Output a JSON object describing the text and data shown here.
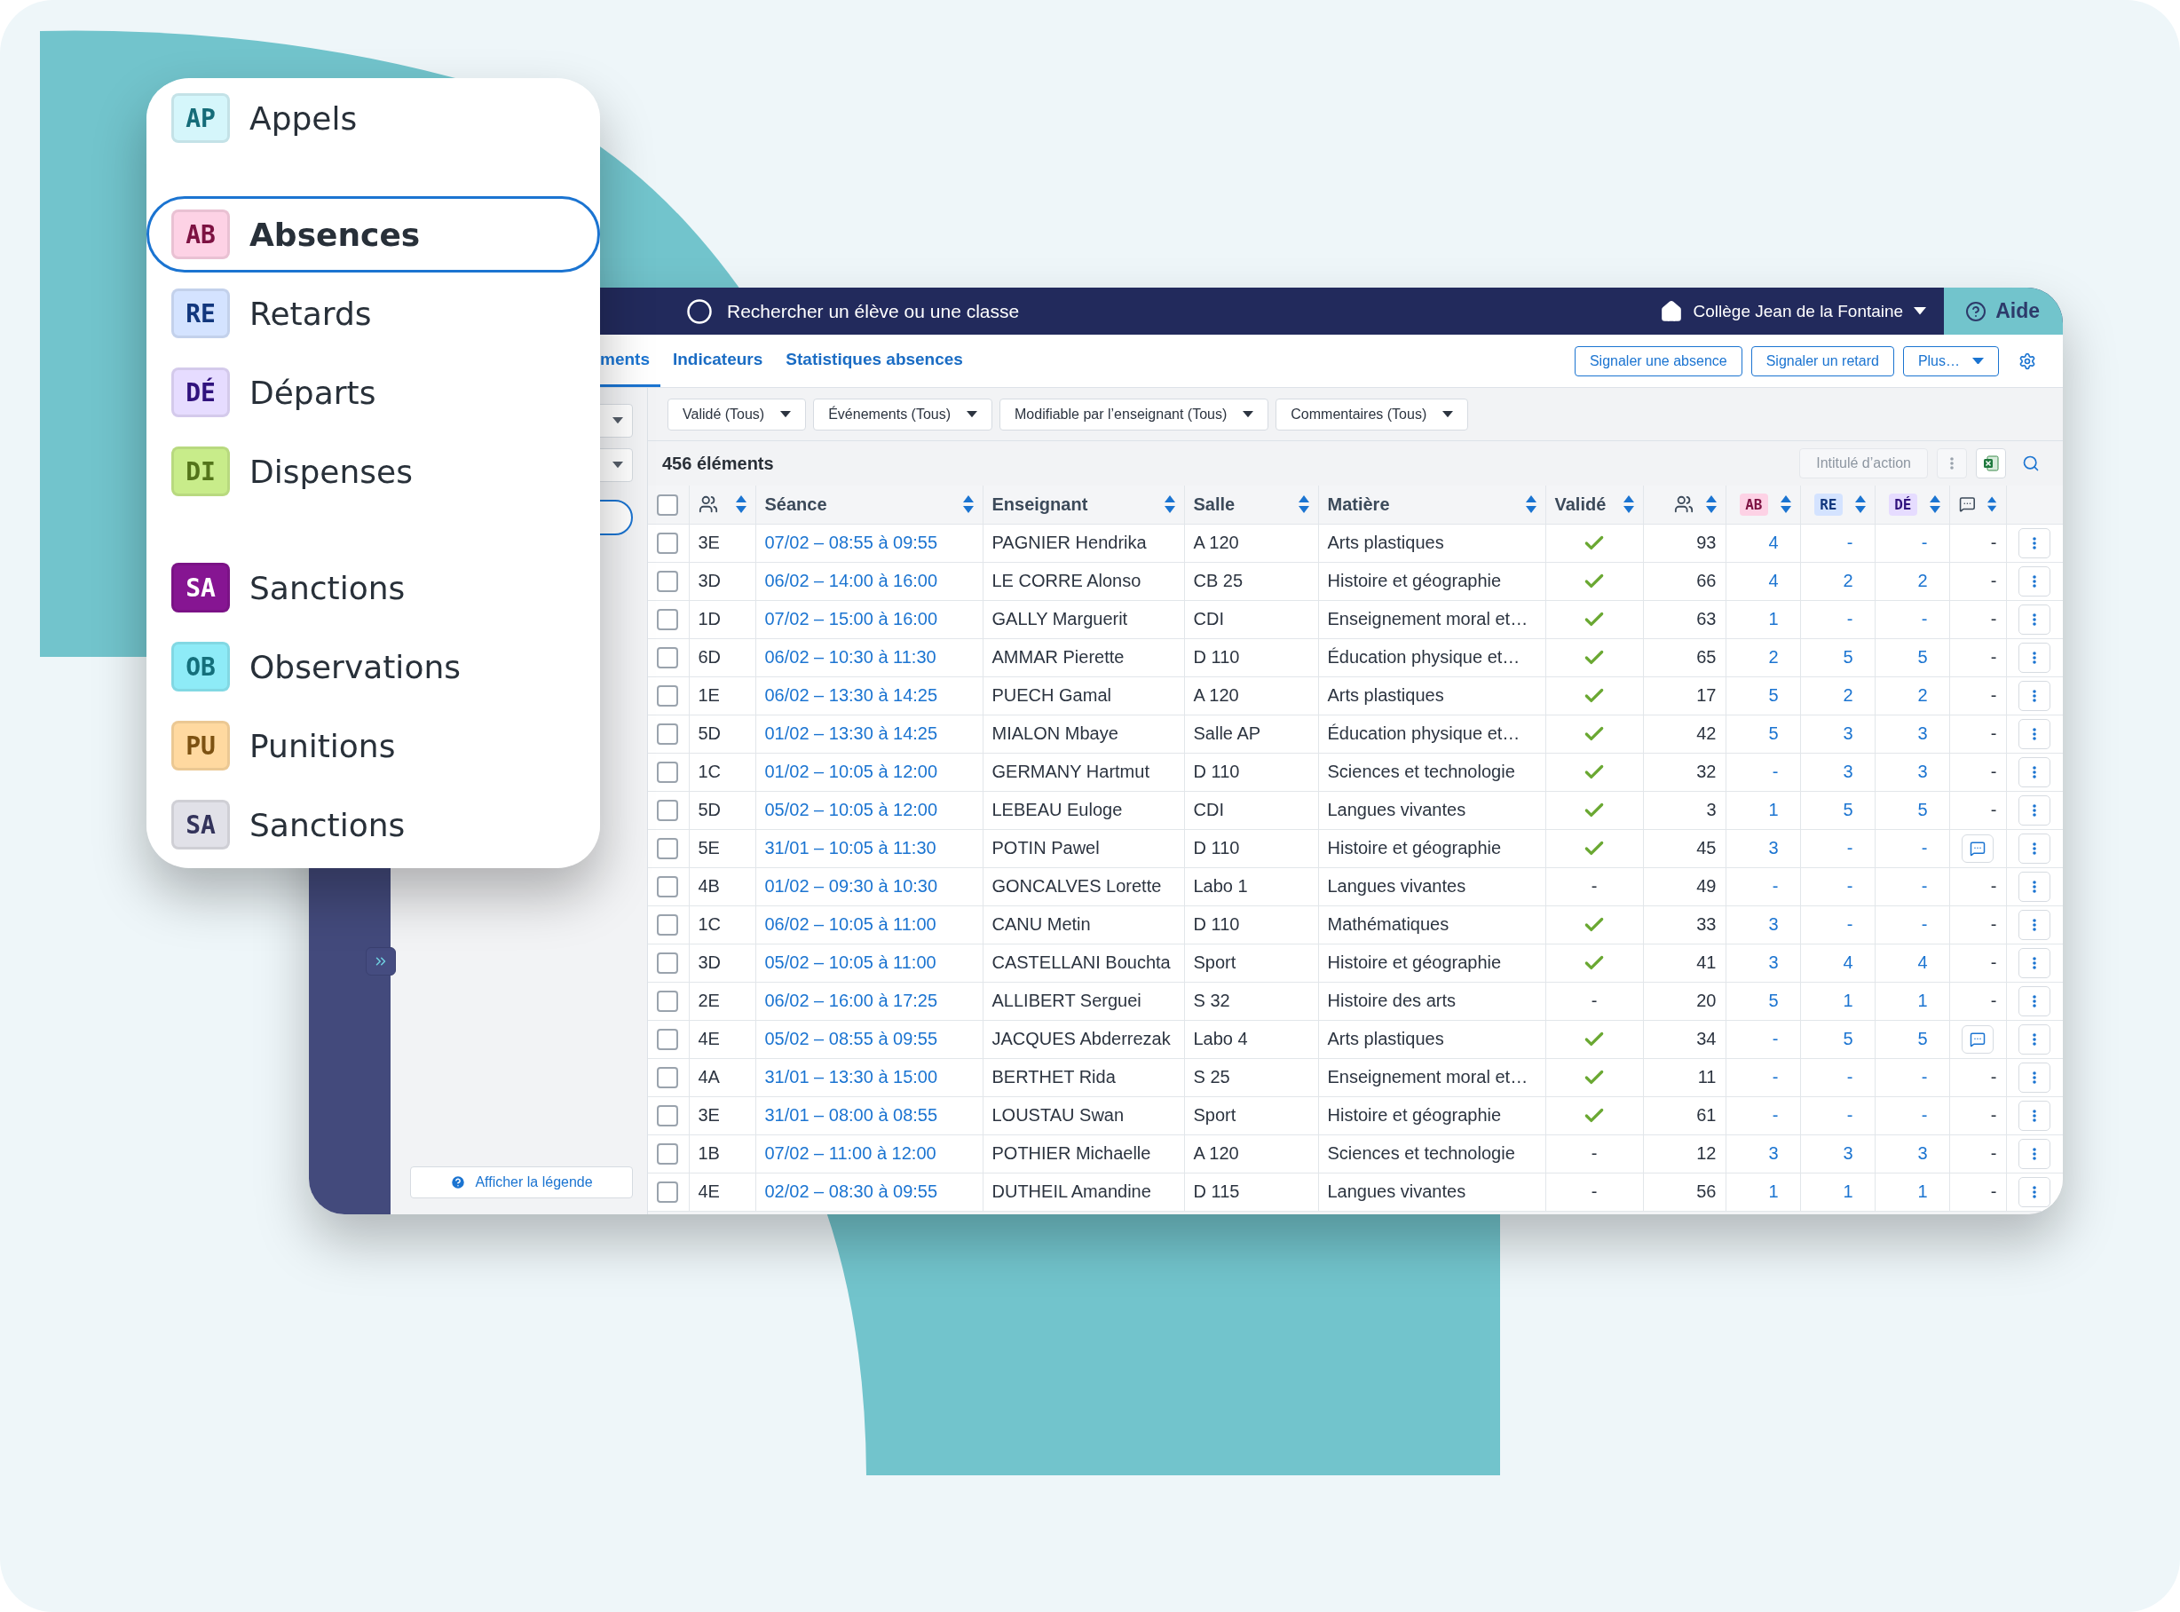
{
  "popup": {
    "groups": [
      {
        "items": [
          {
            "code": "AP",
            "label": "Appels",
            "color": "#d5f6fb",
            "selected": false
          }
        ]
      },
      {
        "items": [
          {
            "code": "AB",
            "label": "Absences",
            "color": "#fdd2e5",
            "selected": true
          },
          {
            "code": "RE",
            "label": "Retards",
            "color": "#d4e3ff",
            "selected": false
          },
          {
            "code": "DÉ",
            "label": "Départs",
            "color": "#e6dcff",
            "selected": false
          },
          {
            "code": "DI",
            "label": "Dispenses",
            "color": "#c8ec8a",
            "selected": false
          }
        ]
      },
      {
        "items": [
          {
            "code": "SA",
            "label": "Sanctions",
            "color": "#861592",
            "selected": false
          },
          {
            "code": "OB",
            "label": "Observations",
            "color": "#8eebf7",
            "selected": false
          },
          {
            "code": "PU",
            "label": "Punitions",
            "color": "#ffd9a0",
            "selected": false
          },
          {
            "code": "SA",
            "label": "Sanctions",
            "color": "#e1e1e8",
            "selected": false
          }
        ]
      }
    ]
  },
  "header": {
    "search": {
      "placeholder": "Rechercher un élève ou une classe"
    },
    "school": "Collège Jean de la Fontaine",
    "help": "Aide"
  },
  "tabs": [
    {
      "label": "ments",
      "selected": true
    },
    {
      "label": "Indicateurs",
      "selected": false
    },
    {
      "label": "Statistiques absences",
      "selected": false
    }
  ],
  "actions": [
    "Signaler une absence",
    "Signaler un retard",
    "Plus…"
  ],
  "filters": [
    "Validé (Tous)",
    "Événements (Tous)",
    "Modifiable par l’enseignant (Tous)",
    "Commentaires (Tous)"
  ],
  "count": "456 éléments",
  "toolbar": {
    "action_label": "Intitulé d’action"
  },
  "legend_button": "Afficher la légende",
  "table": {
    "columns": [
      {
        "kind": "checkbox",
        "checked": false
      },
      {
        "kind": "group-icon"
      },
      {
        "kind": "text",
        "label": "Séance"
      },
      {
        "kind": "text",
        "label": "Enseignant"
      },
      {
        "kind": "text",
        "label": "Salle"
      },
      {
        "kind": "text",
        "label": "Matière"
      },
      {
        "kind": "text",
        "label": "Validé"
      },
      {
        "kind": "count-icon"
      },
      {
        "kind": "badge",
        "label": "AB",
        "color": "#fdd2e5"
      },
      {
        "kind": "badge",
        "label": "RE",
        "color": "#d4e3ff"
      },
      {
        "kind": "badge",
        "label": "DÉ",
        "color": "#e6dcff"
      },
      {
        "kind": "comment-icon"
      }
    ],
    "rows": [
      {
        "selected": false,
        "class": "3E",
        "session": "07/02 – 08:55 à 09:55",
        "teacher": "PAGNIER Hendrika",
        "room": "A 120",
        "subject": "Arts plastiques",
        "validated": true,
        "count": "93",
        "ab": "4",
        "re": "-",
        "de": "-",
        "has_comment": false,
        "comment": "-"
      },
      {
        "selected": false,
        "class": "3D",
        "session": "06/02 – 14:00 à 16:00",
        "teacher": "LE CORRE Alonso",
        "room": "CB 25",
        "subject": "Histoire et géographie",
        "validated": true,
        "count": "66",
        "ab": "4",
        "re": "2",
        "de": "2",
        "has_comment": false,
        "comment": "-"
      },
      {
        "selected": false,
        "class": "1D",
        "session": "07/02 – 15:00 à 16:00",
        "teacher": "GALLY Marguerit",
        "room": "CDI",
        "subject": "Enseignement moral et…",
        "validated": true,
        "count": "63",
        "ab": "1",
        "re": "-",
        "de": "-",
        "has_comment": false,
        "comment": "-"
      },
      {
        "selected": false,
        "class": "6D",
        "session": "06/02 – 10:30 à 11:30",
        "teacher": "AMMAR Pierette",
        "room": "D 110",
        "subject": "Éducation physique et…",
        "validated": true,
        "count": "65",
        "ab": "2",
        "re": "5",
        "de": "5",
        "has_comment": false,
        "comment": "-"
      },
      {
        "selected": false,
        "class": "1E",
        "session": "06/02 – 13:30 à 14:25",
        "teacher": "PUECH Gamal",
        "room": "A 120",
        "subject": "Arts plastiques",
        "validated": true,
        "count": "17",
        "ab": "5",
        "re": "2",
        "de": "2",
        "has_comment": false,
        "comment": "-"
      },
      {
        "selected": false,
        "class": "5D",
        "session": "01/02 – 13:30 à 14:25",
        "teacher": "MIALON Mbaye",
        "room": "Salle AP",
        "subject": "Éducation physique et…",
        "validated": true,
        "count": "42",
        "ab": "5",
        "re": "3",
        "de": "3",
        "has_comment": false,
        "comment": "-"
      },
      {
        "selected": false,
        "class": "1C",
        "session": "01/02 – 10:05 à 12:00",
        "teacher": "GERMANY Hartmut",
        "room": "D 110",
        "subject": "Sciences et technologie",
        "validated": true,
        "count": "32",
        "ab": "-",
        "re": "3",
        "de": "3",
        "has_comment": false,
        "comment": "-"
      },
      {
        "selected": false,
        "class": "5D",
        "session": "05/02 – 10:05 à 12:00",
        "teacher": "LEBEAU Euloge",
        "room": "CDI",
        "subject": "Langues vivantes",
        "validated": true,
        "count": "3",
        "ab": "1",
        "re": "5",
        "de": "5",
        "has_comment": false,
        "comment": "-"
      },
      {
        "selected": false,
        "class": "5E",
        "session": "31/01 – 10:05 à 11:30",
        "teacher": "POTIN Pawel",
        "room": "D 110",
        "subject": "Histoire et géographie",
        "validated": true,
        "count": "45",
        "ab": "3",
        "re": "-",
        "de": "-",
        "has_comment": true
      },
      {
        "selected": false,
        "class": "4B",
        "session": "01/02 – 09:30 à 10:30",
        "teacher": "GONCALVES Lorette",
        "room": "Labo 1",
        "subject": "Langues vivantes",
        "validated": false,
        "validated_text": "-",
        "count": "49",
        "ab": "-",
        "re": "-",
        "de": "-",
        "has_comment": false,
        "comment": "-"
      },
      {
        "selected": false,
        "class": "1C",
        "session": "06/02 – 10:05 à 11:00",
        "teacher": "CANU Metin",
        "room": "D 110",
        "subject": "Mathématiques",
        "validated": true,
        "count": "33",
        "ab": "3",
        "re": "-",
        "de": "-",
        "has_comment": false,
        "comment": "-"
      },
      {
        "selected": false,
        "class": "3D",
        "session": "05/02 – 10:05 à 11:00",
        "teacher": "CASTELLANI Bouchta",
        "room": "Sport",
        "subject": "Histoire et géographie",
        "validated": true,
        "count": "41",
        "ab": "3",
        "re": "4",
        "de": "4",
        "has_comment": false,
        "comment": "-"
      },
      {
        "selected": false,
        "class": "2E",
        "session": "06/02 – 16:00 à 17:25",
        "teacher": "ALLIBERT Serguei",
        "room": "S 32",
        "subject": "Histoire des arts",
        "validated": false,
        "validated_text": "-",
        "count": "20",
        "ab": "5",
        "re": "1",
        "de": "1",
        "has_comment": false,
        "comment": "-"
      },
      {
        "selected": false,
        "class": "4E",
        "session": "05/02 – 08:55 à 09:55",
        "teacher": "JACQUES Abderrezak",
        "room": "Labo 4",
        "subject": "Arts plastiques",
        "validated": true,
        "count": "34",
        "ab": "-",
        "re": "5",
        "de": "5",
        "has_comment": true
      },
      {
        "selected": false,
        "class": "4A",
        "session": "31/01 – 13:30 à 15:00",
        "teacher": "BERTHET Rida",
        "room": "S 25",
        "subject": "Enseignement moral et…",
        "validated": true,
        "count": "11",
        "ab": "-",
        "re": "-",
        "de": "-",
        "has_comment": false,
        "comment": "-"
      },
      {
        "selected": false,
        "class": "3E",
        "session": "31/01 – 08:00 à 08:55",
        "teacher": "LOUSTAU Swan",
        "room": "Sport",
        "subject": "Histoire et géographie",
        "validated": true,
        "count": "61",
        "ab": "-",
        "re": "-",
        "de": "-",
        "has_comment": false,
        "comment": "-"
      },
      {
        "selected": false,
        "class": "1B",
        "session": "07/02 – 11:00 à 12:00",
        "teacher": "POTHIER Michaelle",
        "room": "A 120",
        "subject": "Sciences et technologie",
        "validated": false,
        "validated_text": "-",
        "count": "12",
        "ab": "3",
        "re": "3",
        "de": "3",
        "has_comment": false,
        "comment": "-"
      },
      {
        "selected": false,
        "class": "4E",
        "session": "02/02 – 08:30 à 09:55",
        "teacher": "DUTHEIL Amandine",
        "room": "D 115",
        "subject": "Langues vivantes",
        "validated": false,
        "validated_text": "-",
        "count": "56",
        "ab": "1",
        "re": "1",
        "de": "1",
        "has_comment": false,
        "comment": "-"
      }
    ]
  }
}
